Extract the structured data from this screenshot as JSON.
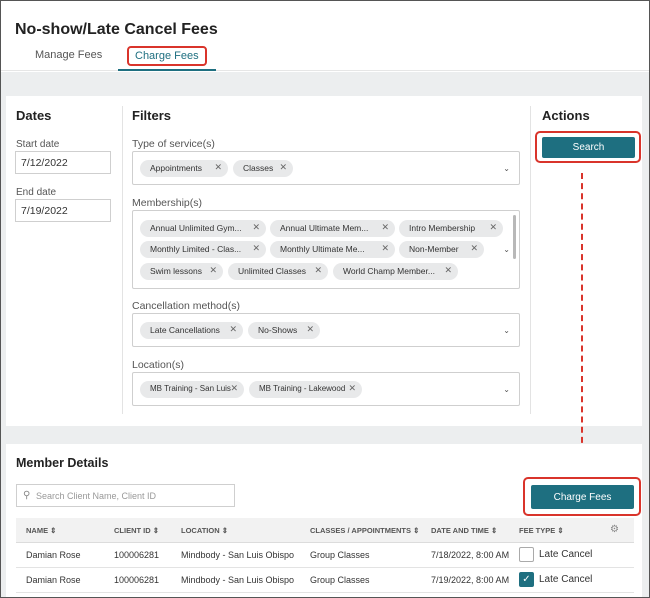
{
  "page": {
    "title": "No-show/Late Cancel Fees"
  },
  "tabs": [
    {
      "label": "Manage Fees"
    },
    {
      "label": "Charge Fees"
    }
  ],
  "dates": {
    "title": "Dates",
    "start_label": "Start date",
    "start_value": "7/12/2022",
    "end_label": "End date",
    "end_value": "7/19/2022"
  },
  "filters": {
    "title": "Filters",
    "service": {
      "label": "Type of service(s)",
      "chips": [
        "Appointments",
        "Classes"
      ]
    },
    "membership": {
      "label": "Membership(s)",
      "chips": [
        "Annual Unlimited Gym...",
        "Annual Ultimate Mem...",
        "Intro Membership",
        "Monthly Limited - Clas...",
        "Monthly Ultimate Me...",
        "Non-Member",
        "Swim lessons",
        "Unlimited Classes",
        "World Champ Member..."
      ]
    },
    "cancellation": {
      "label": "Cancellation method(s)",
      "chips": [
        "Late Cancellations",
        "No-Shows"
      ]
    },
    "location": {
      "label": "Location(s)",
      "chips": [
        "MB Training - San Luis",
        "MB Training - Lakewood"
      ]
    }
  },
  "actions": {
    "title": "Actions",
    "search_label": "Search"
  },
  "member_details": {
    "title": "Member Details",
    "search_placeholder": "Search Client Name, Client ID",
    "charge_button": "Charge Fees",
    "columns": [
      "NAME ⇕",
      "CLIENT ID ⇕",
      "LOCATION ⇕",
      "CLASSES / APPOINTMENTS ⇕",
      "DATE AND TIME ⇕",
      "FEE TYPE ⇕"
    ],
    "rows": [
      {
        "name": "Damian Rose",
        "client_id": "100006281",
        "location": "Mindbody - San Luis Obispo",
        "classes": "Group Classes",
        "date_time": "7/18/2022, 8:00 AM",
        "fee_type": "Late Cancel",
        "checked": false
      },
      {
        "name": "Damian Rose",
        "client_id": "100006281",
        "location": "Mindbody - San Luis Obispo",
        "classes": "Group Classes",
        "date_time": "7/19/2022, 8:00 AM",
        "fee_type": "Late Cancel",
        "checked": true
      }
    ]
  },
  "icons": {
    "close": "close-icon",
    "chevron": "chevron-down-icon",
    "search": "search-icon",
    "gear": "gear-icon",
    "check": "check-icon",
    "sort": "sort-icon"
  },
  "colors": {
    "accent": "#1e6f80",
    "highlight": "#d9342b"
  }
}
